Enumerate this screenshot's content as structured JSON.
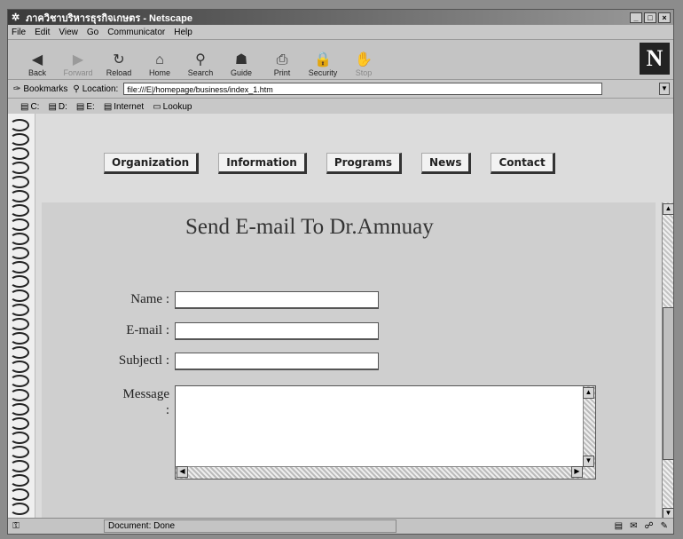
{
  "window": {
    "title": "ภาควิชาบริหารธุรกิจเกษตร - Netscape",
    "controls": [
      "_",
      "□",
      "×"
    ]
  },
  "menubar": [
    "File",
    "Edit",
    "View",
    "Go",
    "Communicator",
    "Help"
  ],
  "toolbar": {
    "buttons": [
      {
        "label": "Back",
        "icon": "back-arrow-icon",
        "glyph": "◀",
        "enabled": true
      },
      {
        "label": "Forward",
        "icon": "forward-arrow-icon",
        "glyph": "▶",
        "enabled": false
      },
      {
        "label": "Reload",
        "icon": "reload-icon",
        "glyph": "↻",
        "enabled": true
      },
      {
        "label": "Home",
        "icon": "home-icon",
        "glyph": "⌂",
        "enabled": true
      },
      {
        "label": "Search",
        "icon": "search-icon",
        "glyph": "⚲",
        "enabled": true
      },
      {
        "label": "Guide",
        "icon": "guide-icon",
        "glyph": "☗",
        "enabled": true
      },
      {
        "label": "Print",
        "icon": "print-icon",
        "glyph": "⎙",
        "enabled": true
      },
      {
        "label": "Security",
        "icon": "lock-icon",
        "glyph": "🔒",
        "enabled": true
      },
      {
        "label": "Stop",
        "icon": "stop-icon",
        "glyph": "✋",
        "enabled": false
      }
    ],
    "logo": "N"
  },
  "location_bar": {
    "bookmarks_label": "Bookmarks",
    "location_label": "Location:",
    "url": "file:///E|/homepage/business/index_1.htm"
  },
  "personal_toolbar": [
    "C:",
    "D:",
    "E:",
    "Internet",
    "Lookup"
  ],
  "nav": [
    "Organization",
    "Information",
    "Programs",
    "News",
    "Contact"
  ],
  "form": {
    "title": "Send E-mail To Dr.Amnuay",
    "name_label": "Name :",
    "email_label": "E-mail :",
    "subject_label": "Subjectl :",
    "message_label": "Message",
    "message_colon": ":",
    "name_value": "",
    "email_value": "",
    "subject_value": "",
    "message_value": ""
  },
  "status": {
    "text": "Document: Done"
  }
}
